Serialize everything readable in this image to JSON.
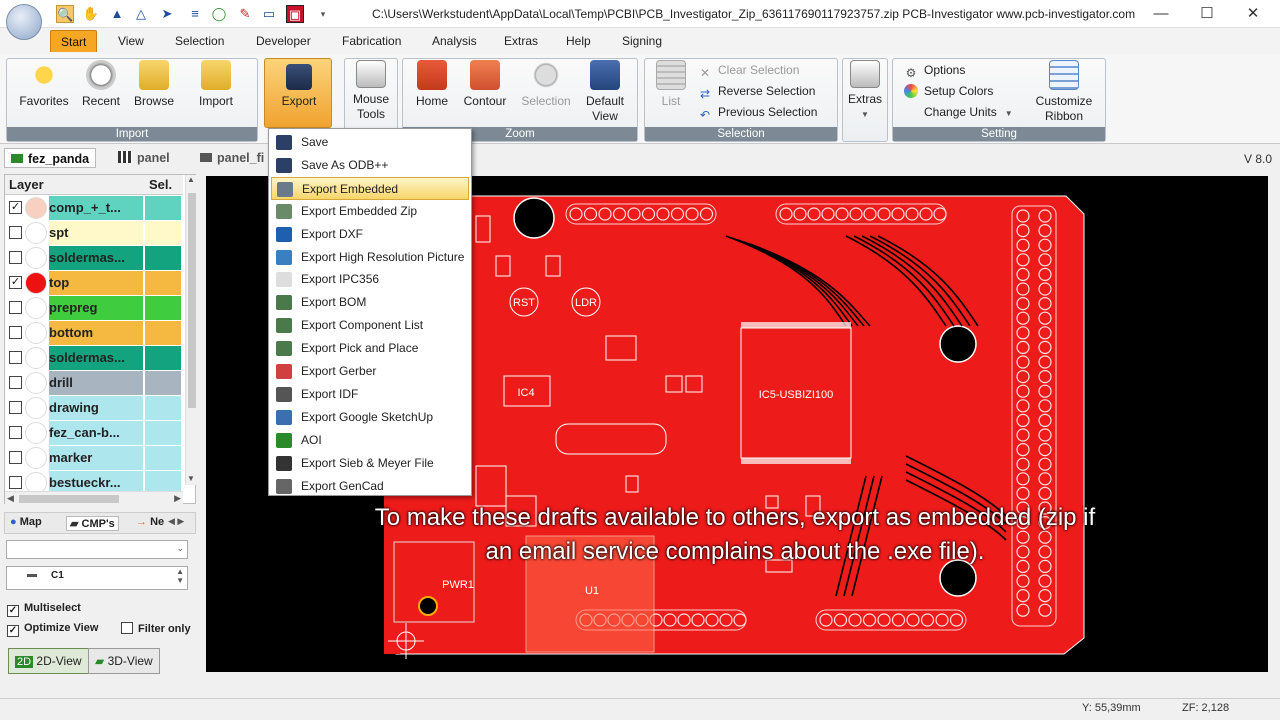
{
  "window": {
    "title": "C:\\Users\\Werkstudent\\AppData\\Local\\Temp\\PCBI\\PCB_Investigator_Zip_636117690117923757.zip   PCB-Investigator   www.pcb-investigator.com",
    "minimize": "—",
    "maximize": "☐",
    "close": "✕"
  },
  "quick_access": [
    "search-icon",
    "hand-icon",
    "arrow-up-icon",
    "arrow-up-alt-icon",
    "measure-icon",
    "circle-icon",
    "pen-icon",
    "box-icon",
    "pcb-icon",
    "dropdown-icon"
  ],
  "ribbon_tabs": [
    "Start",
    "View",
    "Selection",
    "Developer",
    "Fabrication",
    "Analysis",
    "Extras",
    "Help",
    "Signing"
  ],
  "ribbon": {
    "import_group": {
      "label": "Import",
      "buttons": [
        "Favorites",
        "Recent",
        "Browse",
        "Import"
      ]
    },
    "export_button": "Export",
    "mouse_tools": [
      "Mouse",
      "Tools"
    ],
    "zoom_group": {
      "label": "Zoom",
      "buttons": [
        "Home",
        "Contour",
        "Selection"
      ],
      "default_view": [
        "Default",
        "View"
      ]
    },
    "selection_group": {
      "label": "Selection",
      "list": "List",
      "items": [
        "Clear Selection",
        "Reverse Selection",
        "Previous Selection"
      ]
    },
    "extras_button": "Extras",
    "setting_group": {
      "label": "Setting",
      "items": [
        "Options",
        "Setup Colors",
        "Change Units"
      ],
      "customize": [
        "Customize",
        "Ribbon"
      ]
    }
  },
  "doc_tabs": [
    "fez_panda",
    "panel",
    "panel_fi"
  ],
  "version": "V 8.0",
  "layers": {
    "header": {
      "layer": "Layer",
      "sel": "Sel."
    },
    "rows": [
      {
        "name": "comp_+_t...",
        "checked": true,
        "color": "#5fd3c0",
        "dot": "#f7d0c0"
      },
      {
        "name": "spt",
        "checked": false,
        "color": "#fff8c8",
        "dot": "#ffffff"
      },
      {
        "name": "soldermas...",
        "checked": false,
        "color": "#13a37f",
        "dot": "#ffffff"
      },
      {
        "name": "top",
        "checked": true,
        "color": "#f5b942",
        "dot": "#ee1111"
      },
      {
        "name": "prepreg",
        "checked": false,
        "color": "#3fcc3f",
        "dot": "#ffffff"
      },
      {
        "name": "bottom",
        "checked": false,
        "color": "#f5b942",
        "dot": "#ffffff"
      },
      {
        "name": "soldermas...",
        "checked": false,
        "color": "#13a37f",
        "dot": "#ffffff"
      },
      {
        "name": "drill",
        "checked": false,
        "color": "#a8b4bf",
        "dot": "#ffffff"
      },
      {
        "name": "drawing",
        "checked": false,
        "color": "#aee6ee",
        "dot": "#ffffff"
      },
      {
        "name": "fez_can-b...",
        "checked": false,
        "color": "#aee6ee",
        "dot": "#ffffff"
      },
      {
        "name": "marker",
        "checked": false,
        "color": "#aee6ee",
        "dot": "#ffffff"
      },
      {
        "name": "bestueckr...",
        "checked": false,
        "color": "#aee6ee",
        "dot": "#ffffff"
      }
    ]
  },
  "bottom_panel": {
    "tabs": [
      "Map",
      "CMP's",
      "Ne"
    ],
    "list_item": "C1",
    "options": [
      {
        "label": "Multiselect",
        "checked": true
      },
      {
        "label": "Optimize View",
        "checked": true
      },
      {
        "label": "Filter only",
        "checked": false
      }
    ],
    "view_2d": "2D-View",
    "view_3d": "3D-View",
    "badge_2d": "2D"
  },
  "export_menu": [
    {
      "label": "Save",
      "icon": "save-icon"
    },
    {
      "label": "Save As ODB++",
      "icon": "save-as-icon"
    },
    {
      "label": "Export Embedded",
      "icon": "embedded-icon",
      "highlighted": true
    },
    {
      "label": "Export Embedded Zip",
      "icon": "zip-icon"
    },
    {
      "label": "Export DXF",
      "icon": "dxf-icon"
    },
    {
      "label": "Export High Resolution Picture",
      "icon": "picture-icon"
    },
    {
      "label": "Export IPC356",
      "icon": "ipc-icon"
    },
    {
      "label": "Export BOM",
      "icon": "bom-icon"
    },
    {
      "label": "Export Component List",
      "icon": "component-list-icon"
    },
    {
      "label": "Export Pick and Place",
      "icon": "pick-place-icon"
    },
    {
      "label": "Export Gerber",
      "icon": "gerber-icon"
    },
    {
      "label": "Export IDF",
      "icon": "idf-icon"
    },
    {
      "label": "Export Google SketchUp",
      "icon": "sketchup-icon"
    },
    {
      "label": "AOI",
      "icon": "aoi-icon"
    },
    {
      "label": "Export Sieb & Meyer File",
      "icon": "sieb-meyer-icon"
    },
    {
      "label": "Export GenCad",
      "icon": "gencad-icon"
    }
  ],
  "pcb_labels": {
    "rst": "RST",
    "ldr": "LDR",
    "ic4": "IC4",
    "ic5": "IC5-USBIZI100",
    "pwr": "PWR1",
    "u1": "U1"
  },
  "caption": {
    "line1": "To make these drafts available to others, export as embedded (zip if",
    "line2": "an email service complains about the .exe file)."
  },
  "status": {
    "y": "Y: 55,39mm",
    "zf": "ZF: 2,128"
  }
}
